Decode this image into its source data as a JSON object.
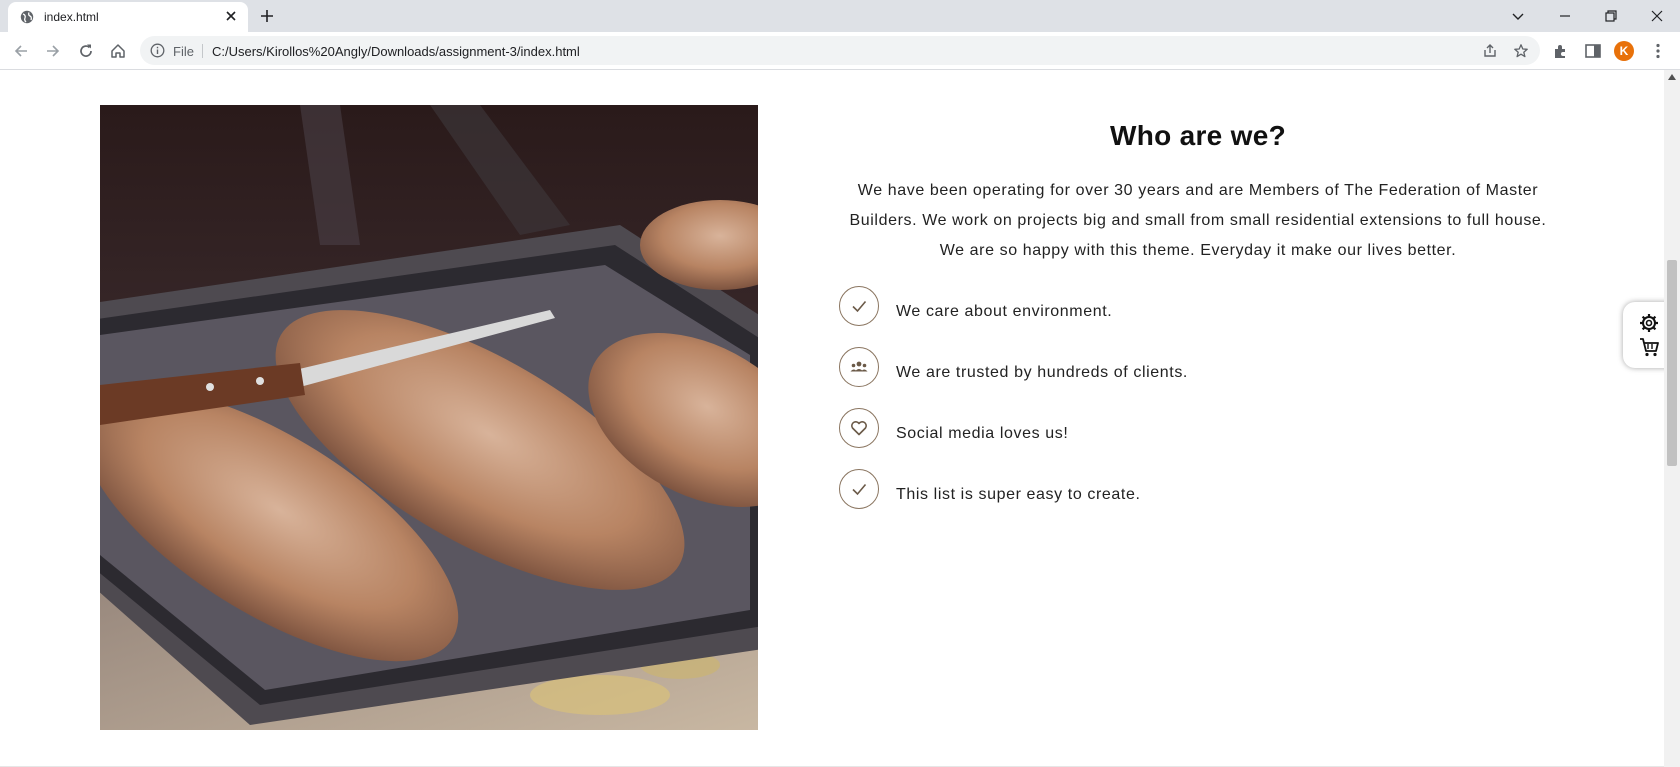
{
  "browser": {
    "tab_title": "index.html",
    "url_scheme": "File",
    "url": "C:/Users/Kirollos%20Angly/Downloads/assignment-3/index.html",
    "profile_initial": "K"
  },
  "section": {
    "title": "Who are we?",
    "description": "We have been operating for over 30 years and are Members of The Federation of Master Builders. We work on projects big and small from small residential extensions to full house. We are so happy with this theme. Everyday it make our lives better.",
    "features": [
      {
        "icon": "check-icon",
        "text": "We care about environment."
      },
      {
        "icon": "group-icon",
        "text": "We are trusted by hundreds of clients."
      },
      {
        "icon": "heart-icon",
        "text": "Social media loves us!"
      },
      {
        "icon": "check-icon",
        "text": "This list is super easy to create."
      }
    ]
  },
  "colors": {
    "accent": "#8a7560",
    "chrome_bg": "#dee1e6",
    "avatar": "#e8710a"
  }
}
